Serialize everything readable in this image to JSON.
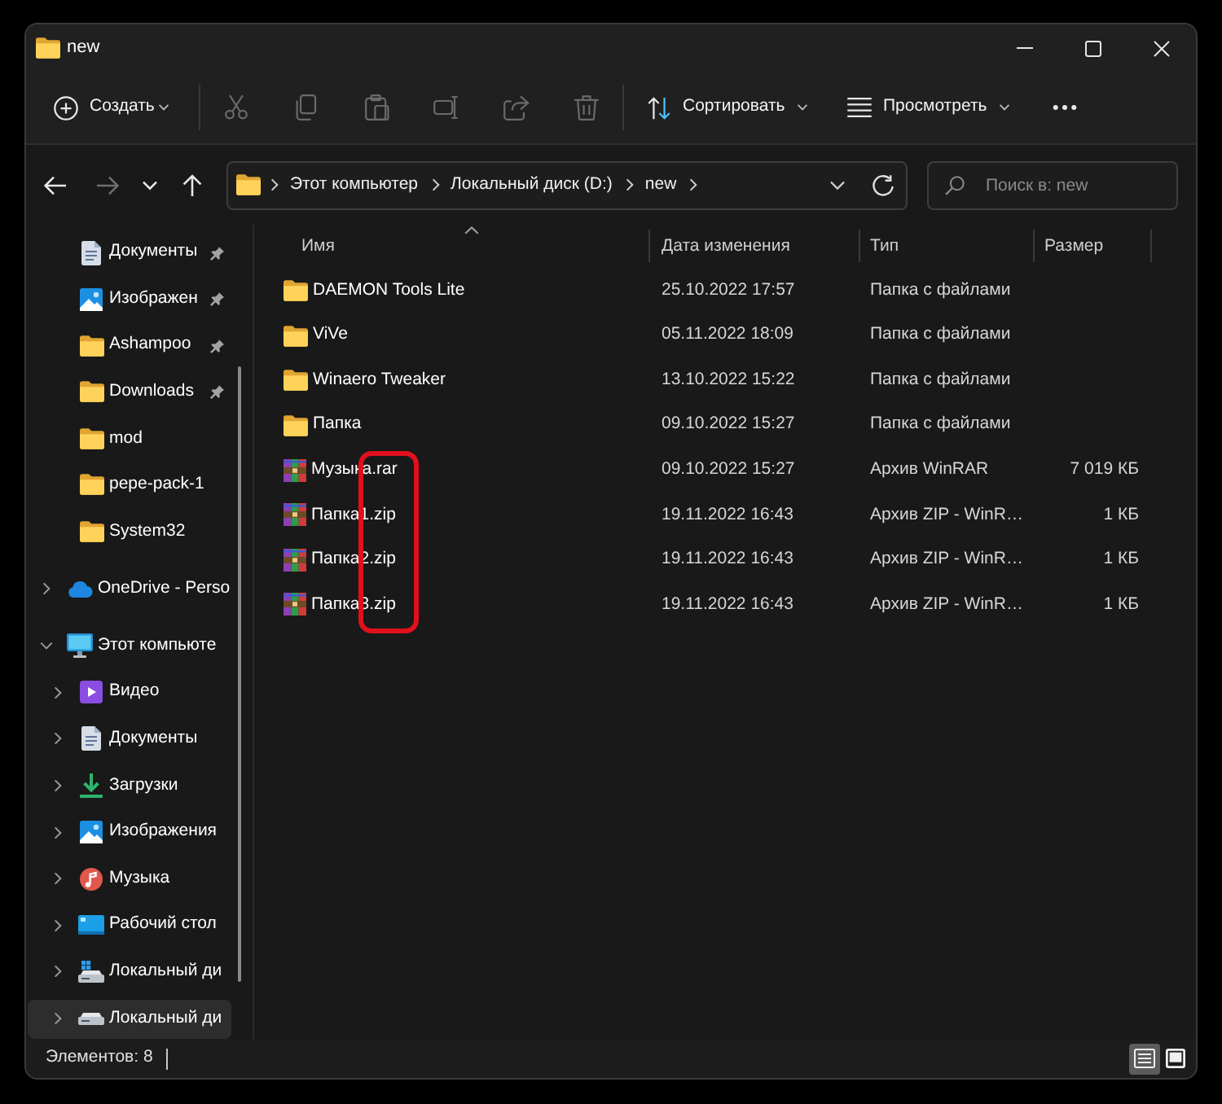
{
  "window": {
    "title": "new"
  },
  "toolbar": {
    "new_button": {
      "label": "Создать"
    },
    "actions": [
      {
        "disabled": true
      },
      {
        "disabled": true
      },
      {
        "disabled": true
      },
      {
        "disabled": true
      },
      {
        "disabled": true
      },
      {
        "disabled": true
      }
    ],
    "sort_button": {
      "label": "Сортировать"
    },
    "view_button": {
      "label": "Просмотреть"
    }
  },
  "navigation": [
    {
      "disabled": false
    },
    {
      "disabled": true
    },
    {
      "disabled": false
    },
    {
      "disabled": false
    }
  ],
  "address_bar": {
    "breadcrumbs": [
      "Этот компьютер",
      "Локальный диск (D:)",
      "new"
    ]
  },
  "search": {
    "placeholder": "Поиск в: new"
  },
  "sidebar": {
    "quick_access": [
      {
        "label": "Документы",
        "kind": "documents",
        "pinned": true,
        "selected": false
      },
      {
        "label": "Изображен",
        "kind": "pictures",
        "pinned": true,
        "selected": false
      },
      {
        "label": "Ashampoo",
        "kind": "folder",
        "pinned": true,
        "selected": false
      },
      {
        "label": "Downloads",
        "kind": "folder",
        "pinned": true,
        "selected": false
      },
      {
        "label": "mod",
        "kind": "folder",
        "pinned": false,
        "selected": false
      },
      {
        "label": "pepe-pack-1",
        "kind": "folder",
        "pinned": false,
        "selected": false
      },
      {
        "label": "System32",
        "kind": "folder",
        "pinned": false,
        "selected": false
      }
    ],
    "tree": [
      {
        "label": "OneDrive - Perso",
        "kind": "cloud",
        "expanded": false,
        "selected": false
      },
      {
        "label": "Этот компьюте",
        "kind": "computer",
        "expanded": true,
        "selected": false,
        "children": [
          {
            "label": "Видео",
            "kind": "video",
            "expanded": false,
            "selected": false
          },
          {
            "label": "Документы",
            "kind": "documents",
            "expanded": false,
            "selected": false
          },
          {
            "label": "Загрузки",
            "kind": "downloads",
            "expanded": false,
            "selected": false
          },
          {
            "label": "Изображения",
            "kind": "pictures",
            "expanded": false,
            "selected": false
          },
          {
            "label": "Музыка",
            "kind": "music",
            "expanded": false,
            "selected": false
          },
          {
            "label": "Рабочий стол",
            "kind": "desktop",
            "expanded": false,
            "selected": false
          },
          {
            "label": "Локальный ди",
            "kind": "system-drive",
            "expanded": false,
            "selected": false
          },
          {
            "label": "Локальный ди",
            "kind": "drive",
            "expanded": false,
            "selected": true
          }
        ]
      }
    ]
  },
  "columns": [
    {
      "label": "Имя",
      "sorted": true
    },
    {
      "label": "Дата изменения",
      "sorted": false
    },
    {
      "label": "Тип",
      "sorted": false
    },
    {
      "label": "Размер",
      "sorted": false
    }
  ],
  "rows": [
    {
      "kind": "folder",
      "name": "DAEMON Tools Lite",
      "date": "25.10.2022 17:57",
      "type": "Папка с файлами",
      "highlighted": false
    },
    {
      "kind": "folder",
      "name": "ViVe",
      "date": "05.11.2022 18:09",
      "type": "Папка с файлами",
      "highlighted": false
    },
    {
      "kind": "folder",
      "name": "Winaero Tweaker",
      "date": "13.10.2022 15:22",
      "type": "Папка с файлами",
      "highlighted": false
    },
    {
      "kind": "folder",
      "name": "Папка",
      "date": "09.10.2022 15:27",
      "type": "Папка с файлами",
      "highlighted": false
    },
    {
      "kind": "archive",
      "name": "Музыка.rar",
      "date": "09.10.2022 15:27",
      "type": "Архив WinRAR",
      "size": "7 019 КБ",
      "highlighted": true
    },
    {
      "kind": "archive",
      "name": "Папка1.zip",
      "date": "19.11.2022 16:43",
      "type": "Архив ZIP - WinR…",
      "size": "1 КБ",
      "highlighted": true
    },
    {
      "kind": "archive",
      "name": "Папка2.zip",
      "date": "19.11.2022 16:43",
      "type": "Архив ZIP - WinR…",
      "size": "1 КБ",
      "highlighted": true
    },
    {
      "kind": "archive",
      "name": "Папка3.zip",
      "date": "19.11.2022 16:43",
      "type": "Архив ZIP - WinR…",
      "size": "1 КБ",
      "highlighted": true
    }
  ],
  "status_bar": {
    "item_count": "Элементов: 8",
    "views": [
      {
        "selected": true
      },
      {
        "selected": false
      }
    ]
  }
}
